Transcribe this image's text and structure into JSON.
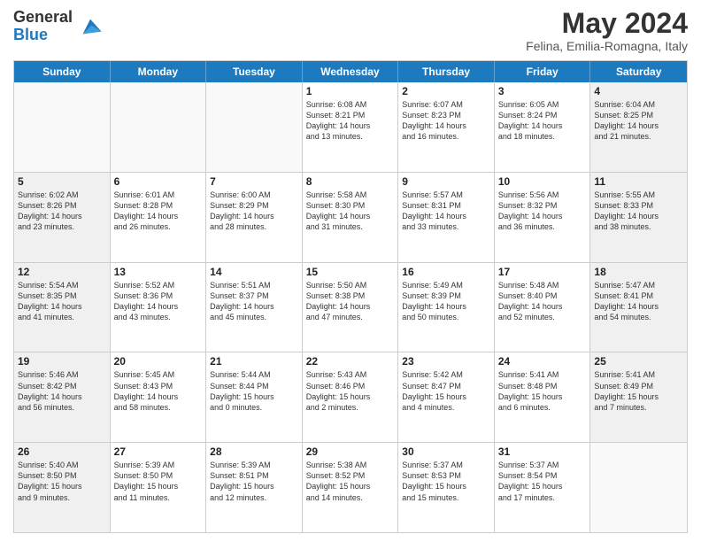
{
  "logo": {
    "general": "General",
    "blue": "Blue",
    "icon_title": "GeneralBlue logo"
  },
  "header": {
    "month": "May 2024",
    "location": "Felina, Emilia-Romagna, Italy"
  },
  "days_of_week": [
    "Sunday",
    "Monday",
    "Tuesday",
    "Wednesday",
    "Thursday",
    "Friday",
    "Saturday"
  ],
  "weeks": [
    [
      {
        "day": "",
        "info": "",
        "empty": true
      },
      {
        "day": "",
        "info": "",
        "empty": true
      },
      {
        "day": "",
        "info": "",
        "empty": true
      },
      {
        "day": "1",
        "info": "Sunrise: 6:08 AM\nSunset: 8:21 PM\nDaylight: 14 hours\nand 13 minutes.",
        "empty": false
      },
      {
        "day": "2",
        "info": "Sunrise: 6:07 AM\nSunset: 8:23 PM\nDaylight: 14 hours\nand 16 minutes.",
        "empty": false
      },
      {
        "day": "3",
        "info": "Sunrise: 6:05 AM\nSunset: 8:24 PM\nDaylight: 14 hours\nand 18 minutes.",
        "empty": false
      },
      {
        "day": "4",
        "info": "Sunrise: 6:04 AM\nSunset: 8:25 PM\nDaylight: 14 hours\nand 21 minutes.",
        "empty": false,
        "shaded": true
      }
    ],
    [
      {
        "day": "5",
        "info": "Sunrise: 6:02 AM\nSunset: 8:26 PM\nDaylight: 14 hours\nand 23 minutes.",
        "shaded": true
      },
      {
        "day": "6",
        "info": "Sunrise: 6:01 AM\nSunset: 8:28 PM\nDaylight: 14 hours\nand 26 minutes."
      },
      {
        "day": "7",
        "info": "Sunrise: 6:00 AM\nSunset: 8:29 PM\nDaylight: 14 hours\nand 28 minutes."
      },
      {
        "day": "8",
        "info": "Sunrise: 5:58 AM\nSunset: 8:30 PM\nDaylight: 14 hours\nand 31 minutes."
      },
      {
        "day": "9",
        "info": "Sunrise: 5:57 AM\nSunset: 8:31 PM\nDaylight: 14 hours\nand 33 minutes."
      },
      {
        "day": "10",
        "info": "Sunrise: 5:56 AM\nSunset: 8:32 PM\nDaylight: 14 hours\nand 36 minutes."
      },
      {
        "day": "11",
        "info": "Sunrise: 5:55 AM\nSunset: 8:33 PM\nDaylight: 14 hours\nand 38 minutes.",
        "shaded": true
      }
    ],
    [
      {
        "day": "12",
        "info": "Sunrise: 5:54 AM\nSunset: 8:35 PM\nDaylight: 14 hours\nand 41 minutes.",
        "shaded": true
      },
      {
        "day": "13",
        "info": "Sunrise: 5:52 AM\nSunset: 8:36 PM\nDaylight: 14 hours\nand 43 minutes."
      },
      {
        "day": "14",
        "info": "Sunrise: 5:51 AM\nSunset: 8:37 PM\nDaylight: 14 hours\nand 45 minutes."
      },
      {
        "day": "15",
        "info": "Sunrise: 5:50 AM\nSunset: 8:38 PM\nDaylight: 14 hours\nand 47 minutes."
      },
      {
        "day": "16",
        "info": "Sunrise: 5:49 AM\nSunset: 8:39 PM\nDaylight: 14 hours\nand 50 minutes."
      },
      {
        "day": "17",
        "info": "Sunrise: 5:48 AM\nSunset: 8:40 PM\nDaylight: 14 hours\nand 52 minutes."
      },
      {
        "day": "18",
        "info": "Sunrise: 5:47 AM\nSunset: 8:41 PM\nDaylight: 14 hours\nand 54 minutes.",
        "shaded": true
      }
    ],
    [
      {
        "day": "19",
        "info": "Sunrise: 5:46 AM\nSunset: 8:42 PM\nDaylight: 14 hours\nand 56 minutes.",
        "shaded": true
      },
      {
        "day": "20",
        "info": "Sunrise: 5:45 AM\nSunset: 8:43 PM\nDaylight: 14 hours\nand 58 minutes."
      },
      {
        "day": "21",
        "info": "Sunrise: 5:44 AM\nSunset: 8:44 PM\nDaylight: 15 hours\nand 0 minutes."
      },
      {
        "day": "22",
        "info": "Sunrise: 5:43 AM\nSunset: 8:46 PM\nDaylight: 15 hours\nand 2 minutes."
      },
      {
        "day": "23",
        "info": "Sunrise: 5:42 AM\nSunset: 8:47 PM\nDaylight: 15 hours\nand 4 minutes."
      },
      {
        "day": "24",
        "info": "Sunrise: 5:41 AM\nSunset: 8:48 PM\nDaylight: 15 hours\nand 6 minutes."
      },
      {
        "day": "25",
        "info": "Sunrise: 5:41 AM\nSunset: 8:49 PM\nDaylight: 15 hours\nand 7 minutes.",
        "shaded": true
      }
    ],
    [
      {
        "day": "26",
        "info": "Sunrise: 5:40 AM\nSunset: 8:50 PM\nDaylight: 15 hours\nand 9 minutes.",
        "shaded": true
      },
      {
        "day": "27",
        "info": "Sunrise: 5:39 AM\nSunset: 8:50 PM\nDaylight: 15 hours\nand 11 minutes."
      },
      {
        "day": "28",
        "info": "Sunrise: 5:39 AM\nSunset: 8:51 PM\nDaylight: 15 hours\nand 12 minutes."
      },
      {
        "day": "29",
        "info": "Sunrise: 5:38 AM\nSunset: 8:52 PM\nDaylight: 15 hours\nand 14 minutes."
      },
      {
        "day": "30",
        "info": "Sunrise: 5:37 AM\nSunset: 8:53 PM\nDaylight: 15 hours\nand 15 minutes."
      },
      {
        "day": "31",
        "info": "Sunrise: 5:37 AM\nSunset: 8:54 PM\nDaylight: 15 hours\nand 17 minutes."
      },
      {
        "day": "",
        "info": "",
        "empty": true,
        "shaded": true
      }
    ]
  ]
}
